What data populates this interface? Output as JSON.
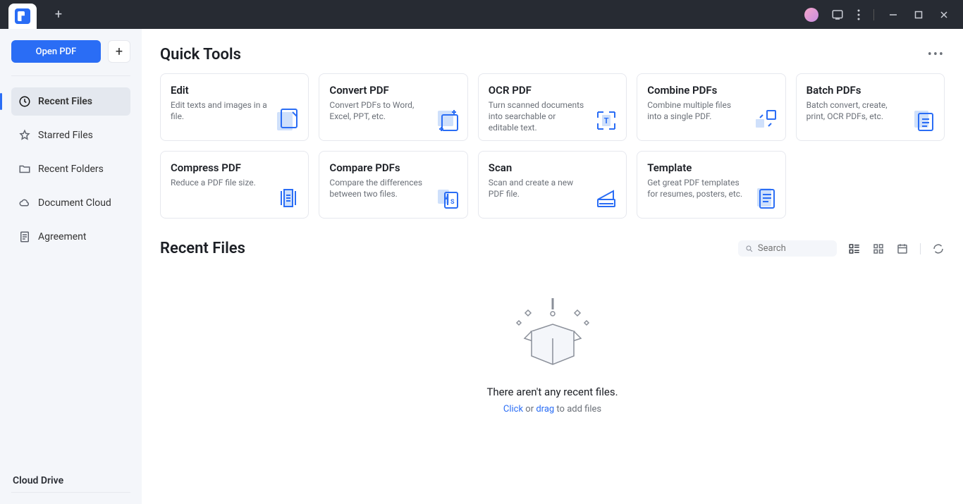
{
  "titlebar": {
    "new_tab": "+"
  },
  "sidebar": {
    "open_label": "Open PDF",
    "plus": "+",
    "items": [
      {
        "label": "Recent Files",
        "icon": "clock-icon",
        "active": true
      },
      {
        "label": "Starred Files",
        "icon": "star-icon",
        "active": false
      },
      {
        "label": "Recent Folders",
        "icon": "folder-icon",
        "active": false
      },
      {
        "label": "Document Cloud",
        "icon": "cloud-icon",
        "active": false
      },
      {
        "label": "Agreement",
        "icon": "agreement-icon",
        "active": false
      }
    ],
    "cloud_drive": "Cloud Drive"
  },
  "quick_tools": {
    "title": "Quick Tools",
    "cards": [
      {
        "title": "Edit",
        "desc": "Edit texts and images in a file."
      },
      {
        "title": "Convert PDF",
        "desc": "Convert PDFs to Word, Excel, PPT, etc."
      },
      {
        "title": "OCR PDF",
        "desc": "Turn scanned documents into searchable or editable text."
      },
      {
        "title": "Combine PDFs",
        "desc": "Combine multiple files into a single PDF."
      },
      {
        "title": "Batch PDFs",
        "desc": "Batch convert, create, print, OCR PDFs, etc."
      },
      {
        "title": "Compress PDF",
        "desc": "Reduce a PDF file size."
      },
      {
        "title": "Compare PDFs",
        "desc": "Compare the differences between two files."
      },
      {
        "title": "Scan",
        "desc": "Scan and create a new PDF file."
      },
      {
        "title": "Template",
        "desc": "Get great PDF templates for resumes, posters, etc."
      }
    ]
  },
  "recent": {
    "title": "Recent Files",
    "search_placeholder": "Search",
    "empty_title": "There aren't any recent files.",
    "empty_click": "Click",
    "empty_or": " or ",
    "empty_drag": "drag",
    "empty_suffix": " to add files"
  }
}
